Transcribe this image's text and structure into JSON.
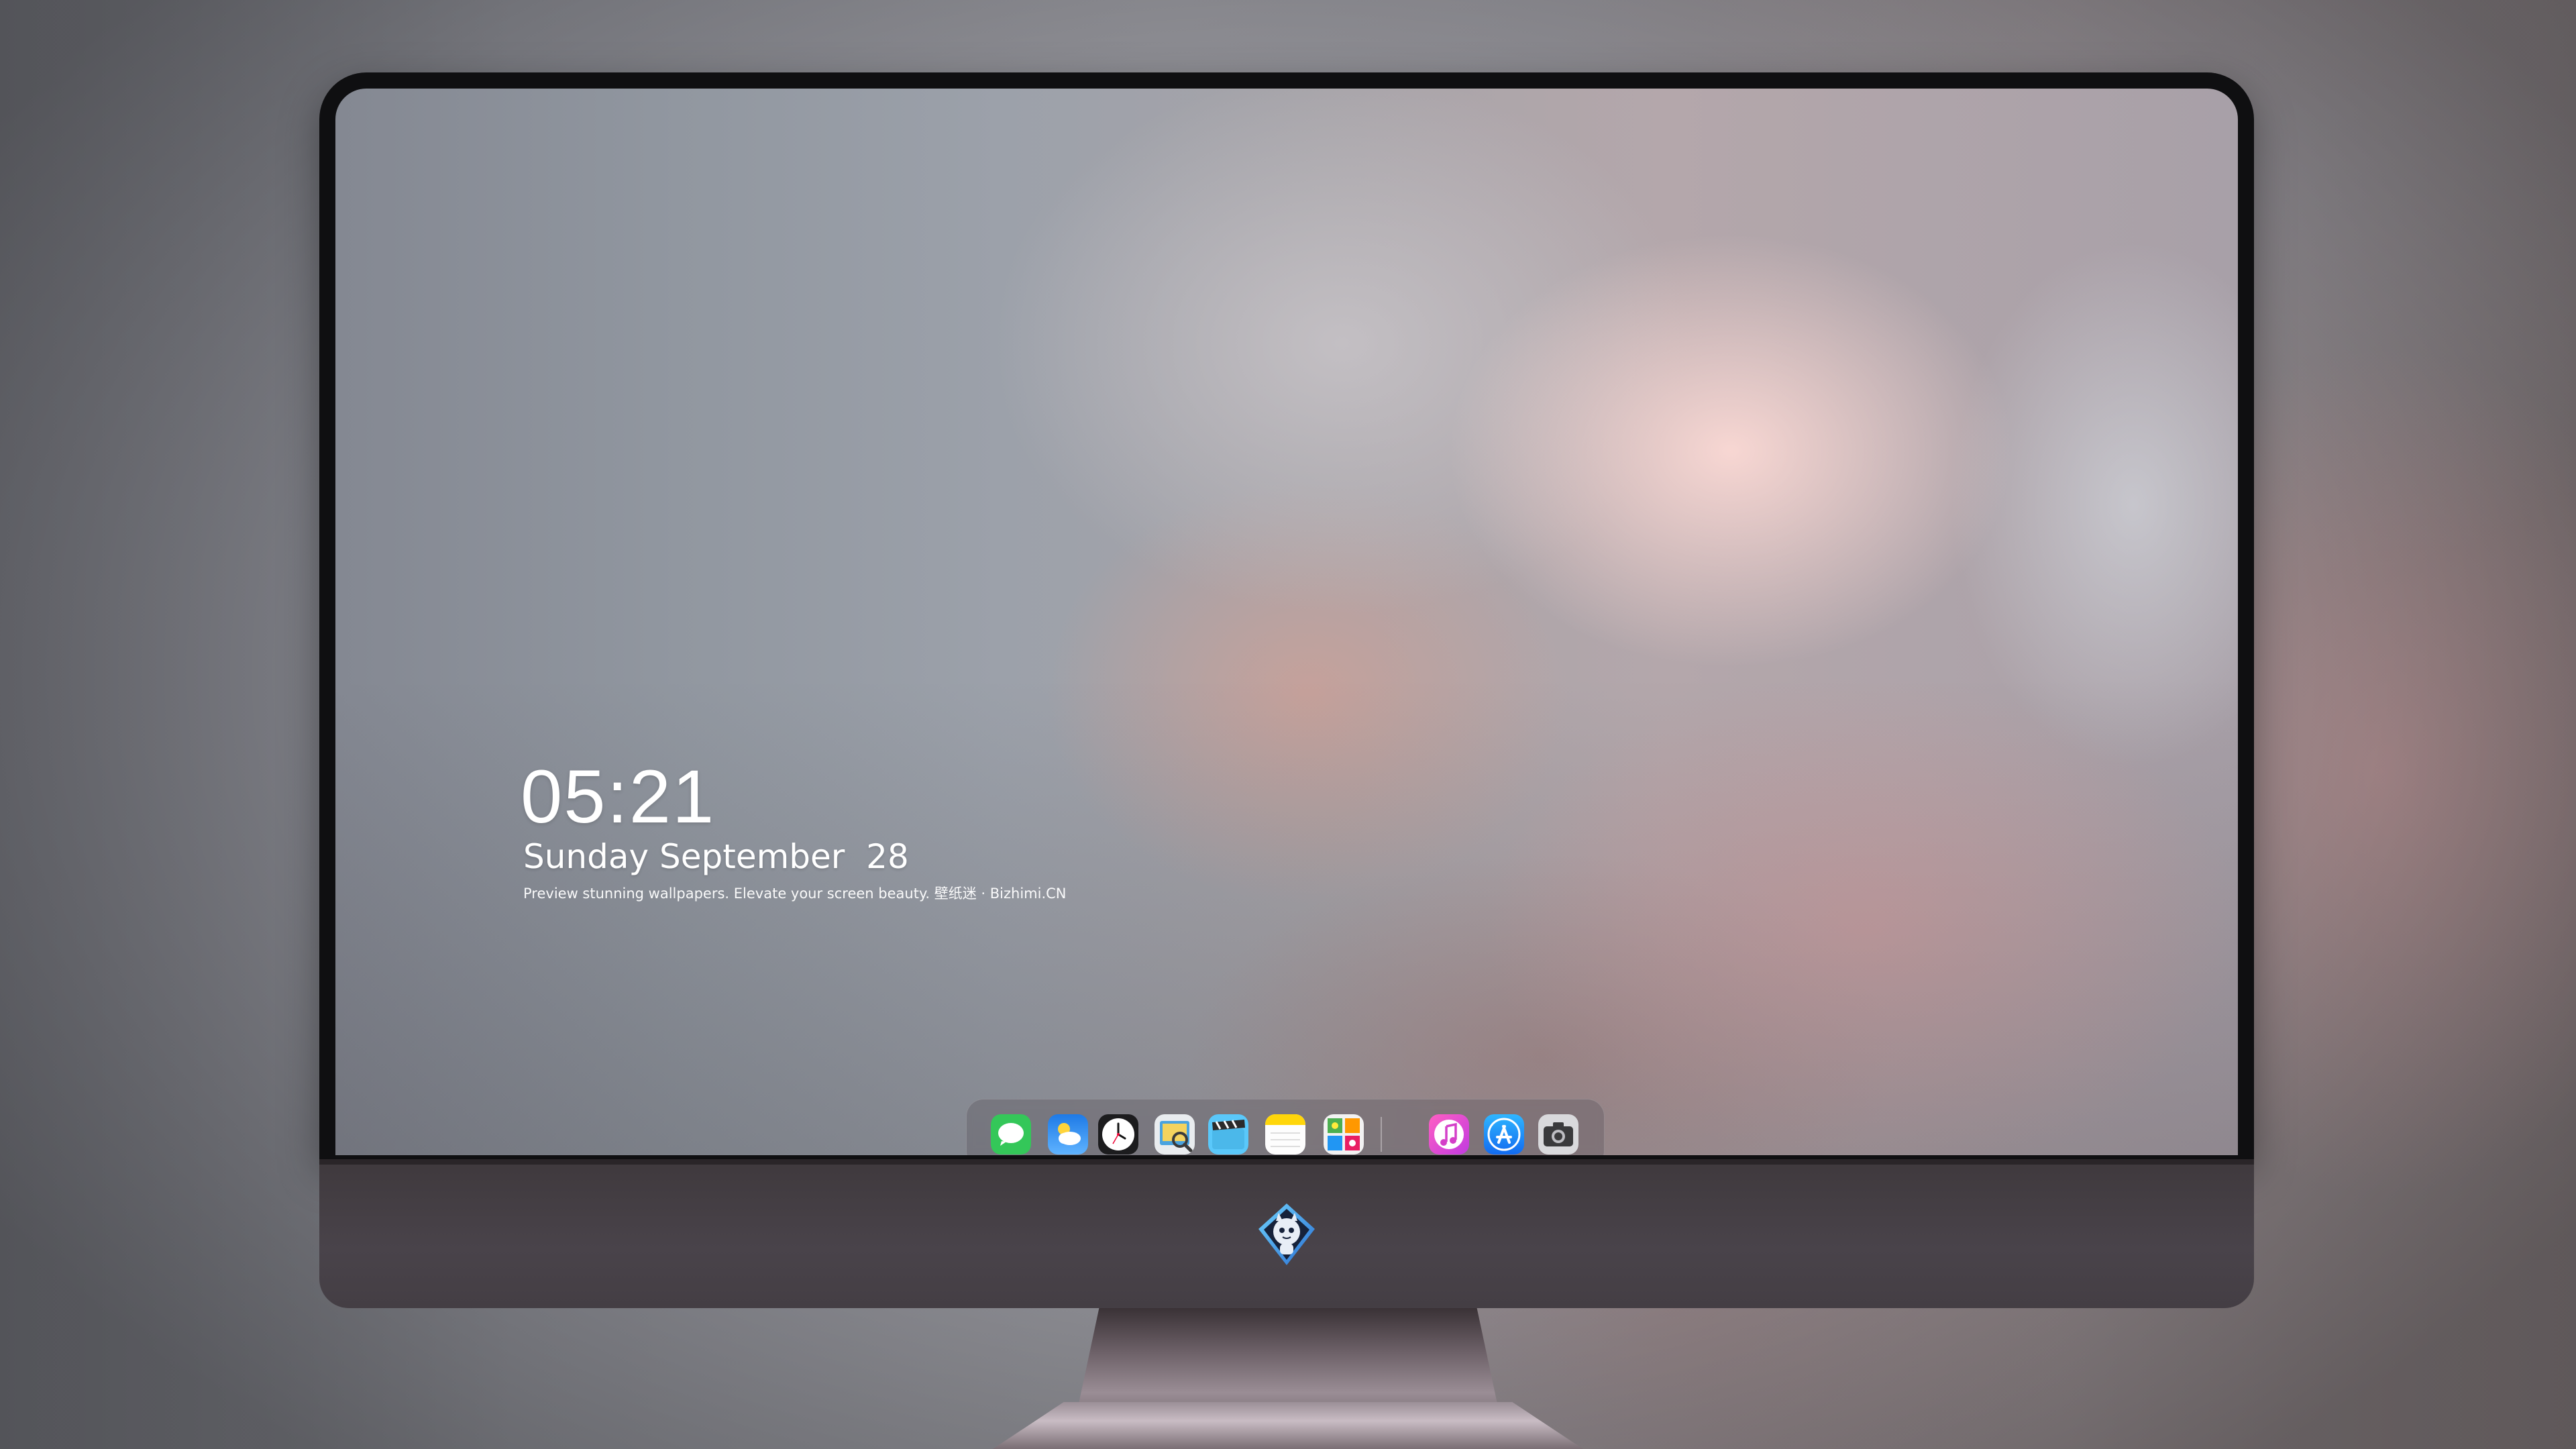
{
  "lock_screen": {
    "time": "05:21",
    "date": "Sunday September  28",
    "tagline": "Preview stunning wallpapers. Elevate your screen beauty. 壁纸迷 · Bizhimi.CN"
  },
  "dock": {
    "apps": [
      {
        "name": "Messages",
        "icon": "messages-icon",
        "color": "#34c759"
      },
      {
        "name": "Weather",
        "icon": "weather-icon",
        "color": "#2f8ff0"
      },
      {
        "name": "Clock",
        "icon": "clock-icon",
        "color": "#1c1c1e"
      },
      {
        "name": "Preview",
        "icon": "preview-icon",
        "color": "#f0b840"
      },
      {
        "name": "Clips",
        "icon": "clips-icon",
        "color": "#5ac8fa"
      },
      {
        "name": "Notes",
        "icon": "notes-icon",
        "color": "#ffd60a"
      },
      {
        "name": "Photo Booth",
        "icon": "photo-booth-icon",
        "color": "#e94b3c"
      },
      {
        "name": "Music",
        "icon": "music-icon",
        "color": "#fc3c8d"
      },
      {
        "name": "App Store",
        "icon": "app-store-icon",
        "color": "#1a8cff"
      },
      {
        "name": "Screenshot",
        "icon": "camera-icon",
        "color": "#3a3a3c"
      }
    ]
  },
  "monitor": {
    "logo": "dragon-mascot-logo"
  }
}
